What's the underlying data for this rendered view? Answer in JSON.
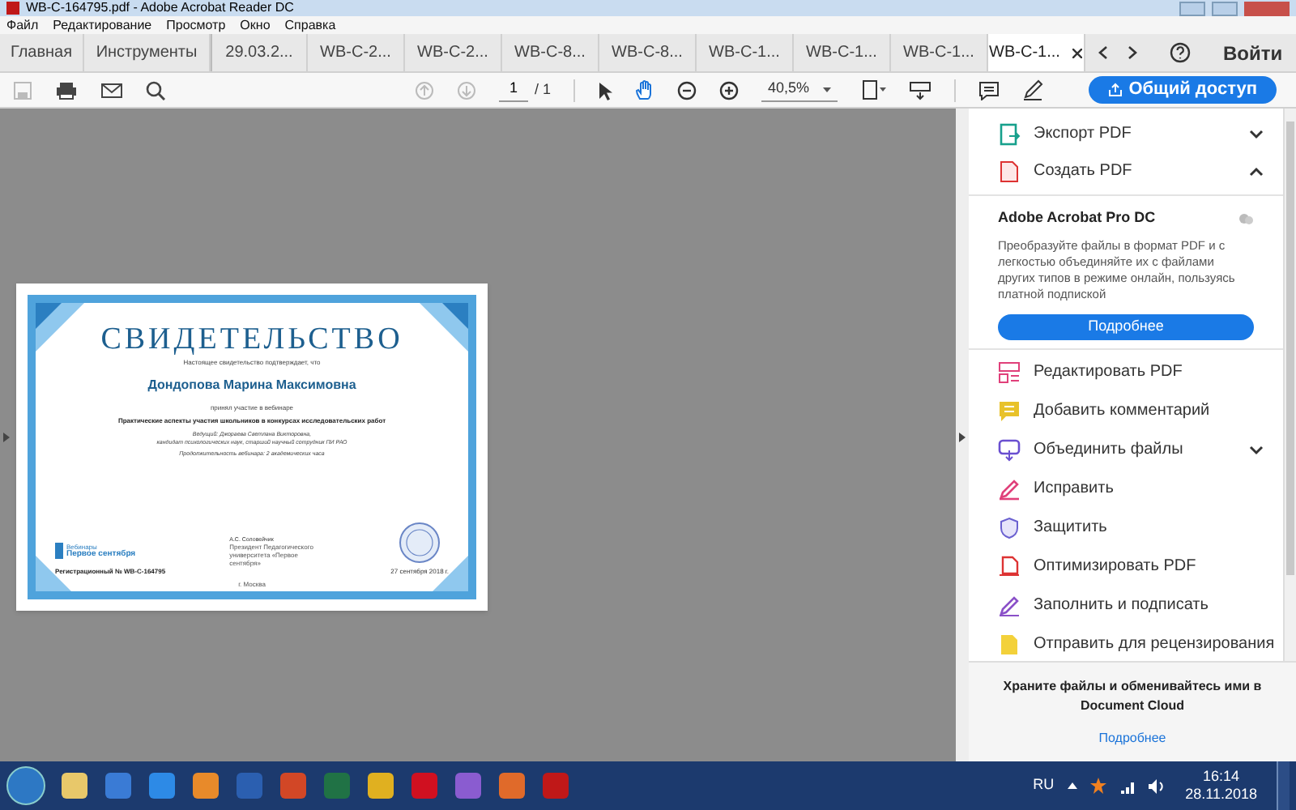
{
  "window": {
    "title": "WB-C-164795.pdf - Adobe Acrobat Reader DC"
  },
  "menu": [
    "Файл",
    "Редактирование",
    "Просмотр",
    "Окно",
    "Справка"
  ],
  "tabs": [
    {
      "label": "Главная",
      "selected": false,
      "kind": "home"
    },
    {
      "label": "Инструменты",
      "selected": false,
      "kind": "home"
    },
    {
      "label": "29.03.2...",
      "selected": false,
      "kind": "doc"
    },
    {
      "label": "WB-C-2...",
      "selected": false,
      "kind": "doc"
    },
    {
      "label": "WB-C-2...",
      "selected": false,
      "kind": "doc"
    },
    {
      "label": "WB-C-8...",
      "selected": false,
      "kind": "doc"
    },
    {
      "label": "WB-C-8...",
      "selected": false,
      "kind": "doc"
    },
    {
      "label": "WB-C-1...",
      "selected": false,
      "kind": "doc"
    },
    {
      "label": "WB-C-1...",
      "selected": false,
      "kind": "doc"
    },
    {
      "label": "WB-C-1...",
      "selected": false,
      "kind": "doc"
    },
    {
      "label": "WB-C-1...",
      "selected": true,
      "kind": "doc"
    }
  ],
  "login": "Войти",
  "toolbar": {
    "page": "1",
    "pages": "/ 1",
    "zoom": "40,5%",
    "share": "Общий доступ"
  },
  "certificate": {
    "title": "СВИДЕТЕЛЬСТВО",
    "intro": "Настоящее свидетельство подтверждает, что",
    "name": "Дондопова Марина Максимовна",
    "participated": "принял участие в вебинаре",
    "topic": "Практические аспекты участия школьников в конкурсах исследовательских работ",
    "host": "Ведущий: Джораева Светлана Викторовна,",
    "host_title": "кандидат психологических наук, старший научный сотрудник ПИ РАО",
    "duration": "Продолжительность вебинара: 2 академических часа",
    "brand_small": "Вебинары",
    "brand": "Первое сентября",
    "signer": "А.С. Соловейчик",
    "signer_title": "Президент Педагогического университета «Первое сентября»",
    "reg": "Регистрационный № WB-C-164795",
    "date": "27 сентября 2018 г.",
    "city": "г. Москва"
  },
  "panel": {
    "sections": [
      {
        "label": "Экспорт PDF",
        "expanded": false,
        "kind": "export"
      },
      {
        "label": "Создать PDF",
        "expanded": true,
        "kind": "create"
      }
    ],
    "promo": {
      "title": "Adobe Acrobat Pro DC",
      "text": "Преобразуйте файлы в формат PDF и с легкостью объединяйте их с файлами других типов в режиме онлайн, пользуясь платной подпиской",
      "button": "Подробнее"
    },
    "tools": [
      {
        "label": "Редактировать PDF",
        "kind": "edit"
      },
      {
        "label": "Добавить комментарий",
        "kind": "comment"
      },
      {
        "label": "Объединить файлы",
        "kind": "combine",
        "expanded": false
      },
      {
        "label": "Исправить",
        "kind": "fix"
      },
      {
        "label": "Защитить",
        "kind": "protect"
      },
      {
        "label": "Оптимизировать PDF",
        "kind": "optimize"
      },
      {
        "label": "Заполнить и подписать",
        "kind": "sign"
      },
      {
        "label": "Отправить для рецензирования",
        "kind": "review"
      }
    ],
    "cloud": {
      "text": "Храните файлы и обменивайтесь ими в Document Cloud",
      "link": "Подробнее"
    }
  },
  "taskbar": {
    "lang": "RU",
    "time": "16:14",
    "date": "28.11.2018"
  }
}
